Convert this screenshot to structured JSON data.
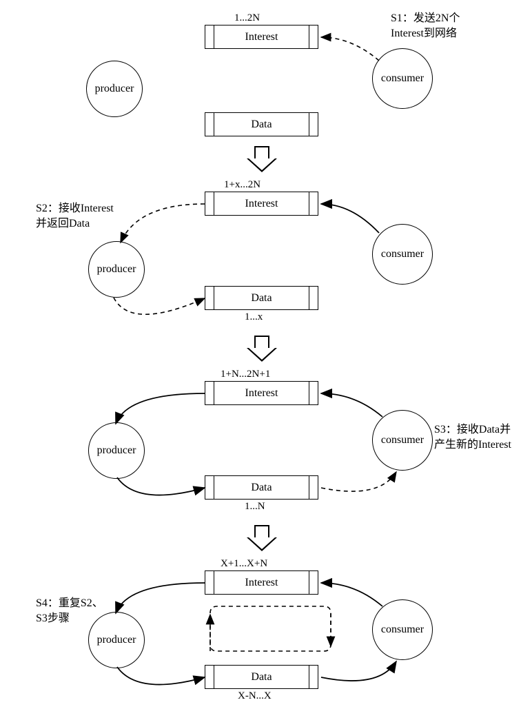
{
  "nodes": {
    "producer": "producer",
    "consumer": "consumer",
    "interest": "Interest",
    "data": "Data"
  },
  "stage1": {
    "interest_range": "1...2N",
    "note": "S1：发送2N个\nInterest到网络"
  },
  "stage2": {
    "interest_range": "1+x...2N",
    "data_range": "1...x",
    "note": "S2：接收Interest\n并返回Data"
  },
  "stage3": {
    "interest_range": "1+N...2N+1",
    "data_range": "1...N",
    "note": "S3：接收Data并\n产生新的Interest"
  },
  "stage4": {
    "interest_range": "X+1...X+N",
    "data_range": "X-N...X",
    "note": "S4：重复S2、\nS3步骤"
  }
}
